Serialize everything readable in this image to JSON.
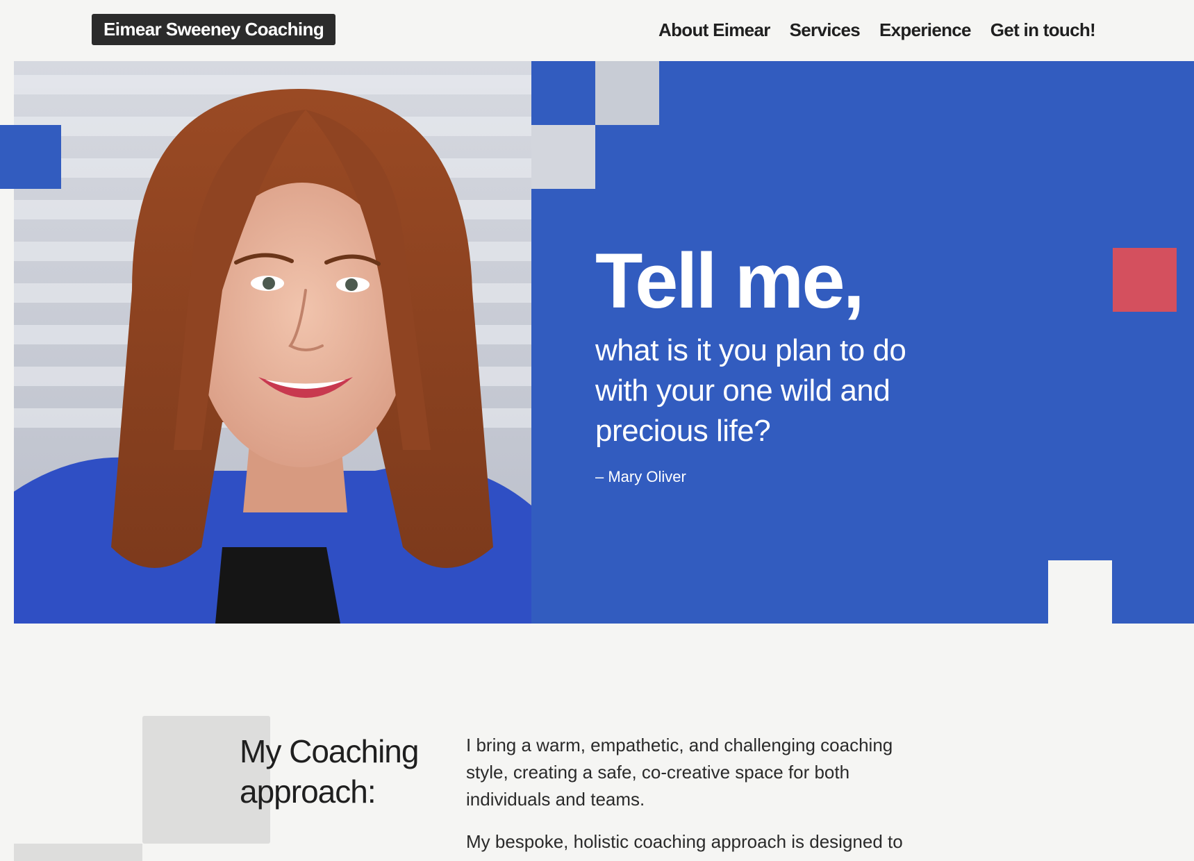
{
  "header": {
    "brand": "Eimear Sweeney Coaching",
    "nav": [
      {
        "label": "About Eimear"
      },
      {
        "label": "Services"
      },
      {
        "label": "Experience"
      },
      {
        "label": "Get in touch!"
      }
    ]
  },
  "hero": {
    "headline": "Tell me,",
    "quote": "what is it you plan to do with your one wild and precious life?",
    "attribution": "– Mary Oliver",
    "photo_alt": "Portrait photo",
    "colors": {
      "panel": "#325cbf",
      "accent_red": "#d4505e",
      "photo_bg": "#c9ccd6"
    }
  },
  "approach": {
    "title": "My Coaching approach:",
    "paragraphs": [
      "I bring a warm, empathetic, and challenging coaching style, creating a safe, co-creative space for both individuals and teams.",
      "My bespoke, holistic coaching approach is designed to"
    ]
  }
}
